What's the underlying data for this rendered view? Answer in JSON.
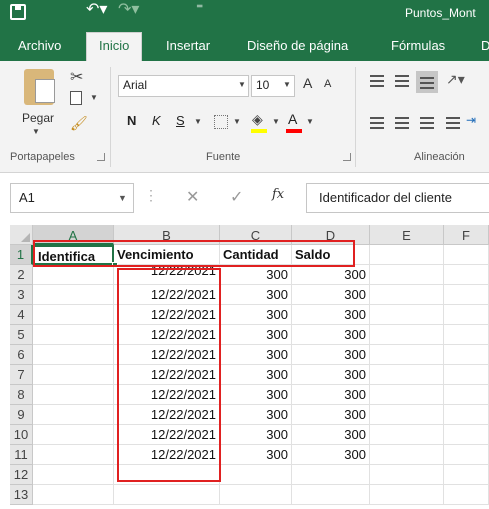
{
  "window": {
    "title": "Puntos_Mont"
  },
  "tabs": [
    {
      "label": "Archivo",
      "active": false
    },
    {
      "label": "Inicio",
      "active": true
    },
    {
      "label": "Insertar",
      "active": false
    },
    {
      "label": "Diseño de página",
      "active": false
    },
    {
      "label": "Fórmulas",
      "active": false
    },
    {
      "label": "D",
      "active": false
    }
  ],
  "ribbon": {
    "clipboard": {
      "paste_label": "Pegar",
      "group_label": "Portapapeles"
    },
    "font": {
      "font_name": "Arial",
      "font_size": "10",
      "group_label": "Fuente",
      "bold": "N",
      "italic": "K",
      "underline": "S",
      "grow": "A",
      "shrink": "A",
      "font_color_glyph": "A",
      "fill_color": "#ffff00",
      "font_color": "#ff0000"
    },
    "alignment": {
      "group_label": "Alineación"
    }
  },
  "formula_bar": {
    "name_box": "A1",
    "fx_label": "fx",
    "content": "Identificador del cliente"
  },
  "sheet": {
    "columns": [
      "A",
      "B",
      "C",
      "D",
      "E",
      "F"
    ],
    "rows": [
      "1",
      "2",
      "3",
      "4",
      "5",
      "6",
      "7",
      "8",
      "9",
      "10",
      "11",
      "12",
      "13"
    ],
    "header_row": [
      "Identifica",
      "Vencimiento",
      "Cantidad",
      "Saldo"
    ],
    "data_rows": [
      [
        "",
        "12/22/2021",
        "300",
        "300"
      ],
      [
        "",
        "12/22/2021",
        "300",
        "300"
      ],
      [
        "",
        "12/22/2021",
        "300",
        "300"
      ],
      [
        "",
        "12/22/2021",
        "300",
        "300"
      ],
      [
        "",
        "12/22/2021",
        "300",
        "300"
      ],
      [
        "",
        "12/22/2021",
        "300",
        "300"
      ],
      [
        "",
        "12/22/2021",
        "300",
        "300"
      ],
      [
        "",
        "12/22/2021",
        "300",
        "300"
      ],
      [
        "",
        "12/22/2021",
        "300",
        "300"
      ],
      [
        "",
        "12/22/2021",
        "300",
        "300"
      ]
    ],
    "selected_cell": "A1"
  },
  "colors": {
    "accent": "#217346",
    "highlight": "#e02020"
  }
}
